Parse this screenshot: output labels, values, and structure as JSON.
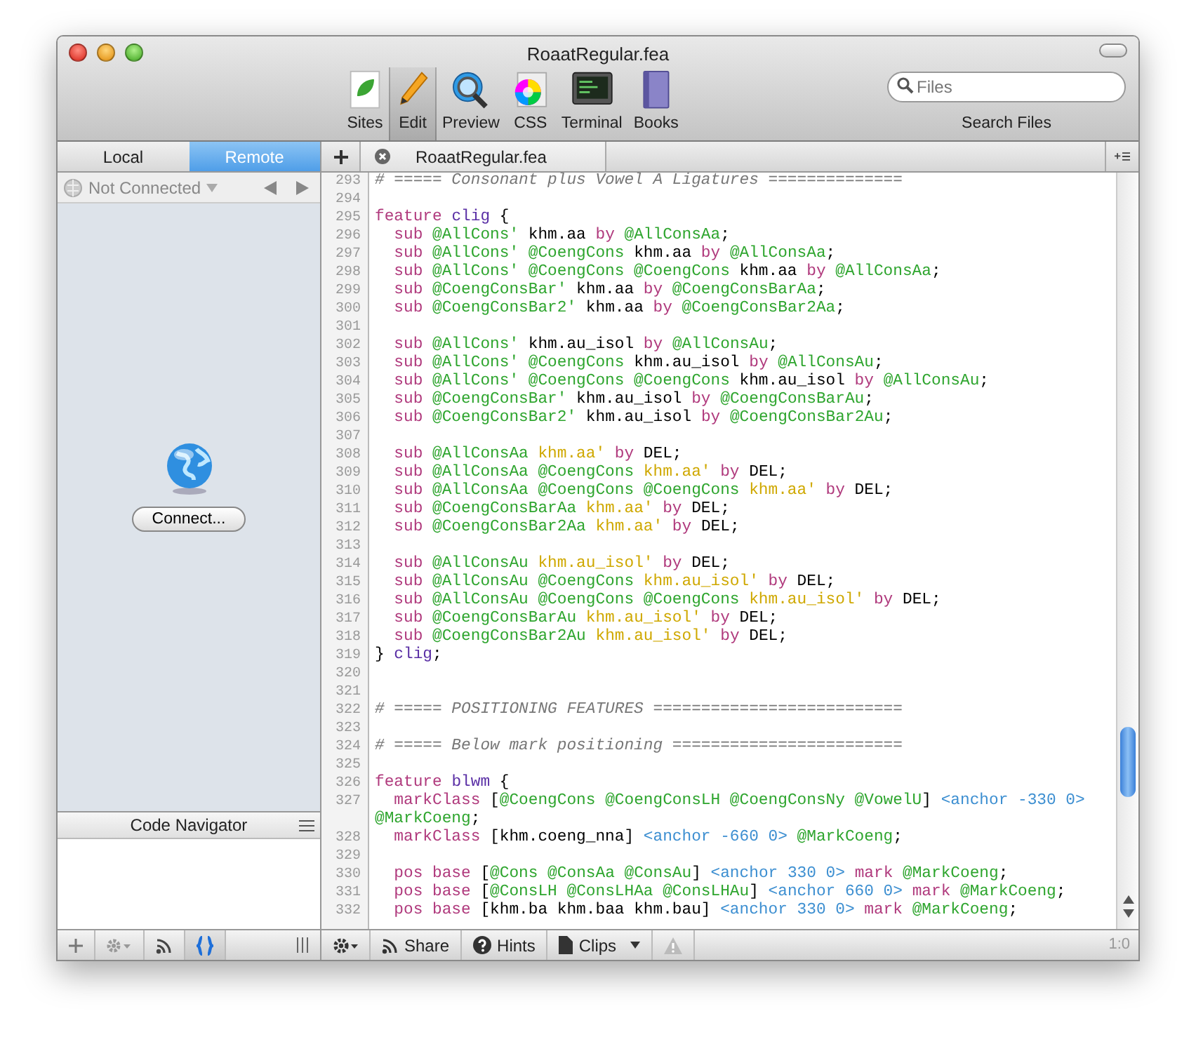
{
  "window": {
    "title": "RoaatRegular.fea"
  },
  "toolbar": {
    "items": [
      {
        "label": "Sites",
        "selected": false
      },
      {
        "label": "Edit",
        "selected": true
      },
      {
        "label": "Preview",
        "selected": false
      },
      {
        "label": "CSS",
        "selected": false
      },
      {
        "label": "Terminal",
        "selected": false
      },
      {
        "label": "Books",
        "selected": false
      }
    ],
    "search": {
      "placeholder": "Files",
      "label": "Search Files"
    }
  },
  "sidebar": {
    "tabs": [
      {
        "label": "Local",
        "selected": false
      },
      {
        "label": "Remote",
        "selected": true
      }
    ],
    "connection": "Not Connected",
    "connect_button": "Connect...",
    "navigator_title": "Code Navigator",
    "bottom_tools": [
      {
        "kind": "plus",
        "selected": false
      },
      {
        "kind": "gear",
        "selected": false
      },
      {
        "kind": "signal",
        "selected": false
      },
      {
        "kind": "braces",
        "selected": true
      },
      {
        "kind": "grip",
        "selected": false
      }
    ]
  },
  "editor": {
    "tab": "RoaatRegular.fea",
    "lines": [
      {
        "number": "293",
        "tokens": [
          {
            "kind": "comment",
            "text": "# ===== Consonant plus Vowel A Ligatures =============="
          }
        ]
      },
      {
        "number": "294"
      },
      {
        "number": "295",
        "tokens": [
          {
            "kind": "keyword",
            "text": "feature "
          },
          {
            "kind": "tag",
            "text": "clig"
          },
          {
            "kind": "plain",
            "text": " {"
          }
        ]
      },
      {
        "number": "296",
        "tokens": [
          {
            "kind": "keyword",
            "text": "  sub "
          },
          {
            "kind": "group",
            "text": "@AllCons'"
          },
          {
            "kind": "plain",
            "text": " khm.aa "
          },
          {
            "kind": "keyword",
            "text": "by "
          },
          {
            "kind": "group",
            "text": "@AllConsAa"
          },
          {
            "kind": "plain",
            "text": ";"
          }
        ]
      },
      {
        "number": "297",
        "tokens": [
          {
            "kind": "keyword",
            "text": "  sub "
          },
          {
            "kind": "group",
            "text": "@AllCons' @CoengCons"
          },
          {
            "kind": "plain",
            "text": " khm.aa "
          },
          {
            "kind": "keyword",
            "text": "by "
          },
          {
            "kind": "group",
            "text": "@AllConsAa"
          },
          {
            "kind": "plain",
            "text": ";"
          }
        ]
      },
      {
        "number": "298",
        "tokens": [
          {
            "kind": "keyword",
            "text": "  sub "
          },
          {
            "kind": "group",
            "text": "@AllCons' @CoengCons @CoengCons"
          },
          {
            "kind": "plain",
            "text": " khm.aa "
          },
          {
            "kind": "keyword",
            "text": "by "
          },
          {
            "kind": "group",
            "text": "@AllConsAa"
          },
          {
            "kind": "plain",
            "text": ";"
          }
        ]
      },
      {
        "number": "299",
        "tokens": [
          {
            "kind": "keyword",
            "text": "  sub "
          },
          {
            "kind": "group",
            "text": "@CoengConsBar'"
          },
          {
            "kind": "plain",
            "text": " khm.aa "
          },
          {
            "kind": "keyword",
            "text": "by "
          },
          {
            "kind": "group",
            "text": "@CoengConsBarAa"
          },
          {
            "kind": "plain",
            "text": ";"
          }
        ]
      },
      {
        "number": "300",
        "tokens": [
          {
            "kind": "keyword",
            "text": "  sub "
          },
          {
            "kind": "group",
            "text": "@CoengConsBar2'"
          },
          {
            "kind": "plain",
            "text": " khm.aa "
          },
          {
            "kind": "keyword",
            "text": "by "
          },
          {
            "kind": "group",
            "text": "@CoengConsBar2Aa"
          },
          {
            "kind": "plain",
            "text": ";"
          }
        ]
      },
      {
        "number": "301"
      },
      {
        "number": "302",
        "tokens": [
          {
            "kind": "keyword",
            "text": "  sub "
          },
          {
            "kind": "group",
            "text": "@AllCons'"
          },
          {
            "kind": "plain",
            "text": " khm.au_isol "
          },
          {
            "kind": "keyword",
            "text": "by "
          },
          {
            "kind": "group",
            "text": "@AllConsAu"
          },
          {
            "kind": "plain",
            "text": ";"
          }
        ]
      },
      {
        "number": "303",
        "tokens": [
          {
            "kind": "keyword",
            "text": "  sub "
          },
          {
            "kind": "group",
            "text": "@AllCons' @CoengCons"
          },
          {
            "kind": "plain",
            "text": " khm.au_isol "
          },
          {
            "kind": "keyword",
            "text": "by "
          },
          {
            "kind": "group",
            "text": "@AllConsAu"
          },
          {
            "kind": "plain",
            "text": ";"
          }
        ]
      },
      {
        "number": "304",
        "tokens": [
          {
            "kind": "keyword",
            "text": "  sub "
          },
          {
            "kind": "group",
            "text": "@AllCons' @CoengCons @CoengCons"
          },
          {
            "kind": "plain",
            "text": " khm.au_isol "
          },
          {
            "kind": "keyword",
            "text": "by "
          },
          {
            "kind": "group",
            "text": "@AllConsAu"
          },
          {
            "kind": "plain",
            "text": ";"
          }
        ]
      },
      {
        "number": "305",
        "tokens": [
          {
            "kind": "keyword",
            "text": "  sub "
          },
          {
            "kind": "group",
            "text": "@CoengConsBar'"
          },
          {
            "kind": "plain",
            "text": " khm.au_isol "
          },
          {
            "kind": "keyword",
            "text": "by "
          },
          {
            "kind": "group",
            "text": "@CoengConsBarAu"
          },
          {
            "kind": "plain",
            "text": ";"
          }
        ]
      },
      {
        "number": "306",
        "tokens": [
          {
            "kind": "keyword",
            "text": "  sub "
          },
          {
            "kind": "group",
            "text": "@CoengConsBar2'"
          },
          {
            "kind": "plain",
            "text": " khm.au_isol "
          },
          {
            "kind": "keyword",
            "text": "by "
          },
          {
            "kind": "group",
            "text": "@CoengConsBar2Au"
          },
          {
            "kind": "plain",
            "text": ";"
          }
        ]
      },
      {
        "number": "307"
      },
      {
        "number": "308",
        "tokens": [
          {
            "kind": "keyword",
            "text": "  sub "
          },
          {
            "kind": "group",
            "text": "@AllConsAa "
          },
          {
            "kind": "glyph",
            "text": "khm.aa' "
          },
          {
            "kind": "keyword",
            "text": "by "
          },
          {
            "kind": "plain",
            "text": "DEL;"
          }
        ]
      },
      {
        "number": "309",
        "tokens": [
          {
            "kind": "keyword",
            "text": "  sub "
          },
          {
            "kind": "group",
            "text": "@AllConsAa @CoengCons "
          },
          {
            "kind": "glyph",
            "text": "khm.aa' "
          },
          {
            "kind": "keyword",
            "text": "by "
          },
          {
            "kind": "plain",
            "text": "DEL;"
          }
        ]
      },
      {
        "number": "310",
        "tokens": [
          {
            "kind": "keyword",
            "text": "  sub "
          },
          {
            "kind": "group",
            "text": "@AllConsAa @CoengCons @CoengCons "
          },
          {
            "kind": "glyph",
            "text": "khm.aa' "
          },
          {
            "kind": "keyword",
            "text": "by "
          },
          {
            "kind": "plain",
            "text": "DEL;"
          }
        ]
      },
      {
        "number": "311",
        "tokens": [
          {
            "kind": "keyword",
            "text": "  sub "
          },
          {
            "kind": "group",
            "text": "@CoengConsBarAa "
          },
          {
            "kind": "glyph",
            "text": "khm.aa' "
          },
          {
            "kind": "keyword",
            "text": "by "
          },
          {
            "kind": "plain",
            "text": "DEL;"
          }
        ]
      },
      {
        "number": "312",
        "tokens": [
          {
            "kind": "keyword",
            "text": "  sub "
          },
          {
            "kind": "group",
            "text": "@CoengConsBar2Aa "
          },
          {
            "kind": "glyph",
            "text": "khm.aa' "
          },
          {
            "kind": "keyword",
            "text": "by "
          },
          {
            "kind": "plain",
            "text": "DEL;"
          }
        ]
      },
      {
        "number": "313"
      },
      {
        "number": "314",
        "tokens": [
          {
            "kind": "keyword",
            "text": "  sub "
          },
          {
            "kind": "group",
            "text": "@AllConsAu "
          },
          {
            "kind": "glyph",
            "text": "khm.au_isol' "
          },
          {
            "kind": "keyword",
            "text": "by "
          },
          {
            "kind": "plain",
            "text": "DEL;"
          }
        ]
      },
      {
        "number": "315",
        "tokens": [
          {
            "kind": "keyword",
            "text": "  sub "
          },
          {
            "kind": "group",
            "text": "@AllConsAu @CoengCons "
          },
          {
            "kind": "glyph",
            "text": "khm.au_isol' "
          },
          {
            "kind": "keyword",
            "text": "by "
          },
          {
            "kind": "plain",
            "text": "DEL;"
          }
        ]
      },
      {
        "number": "316",
        "tokens": [
          {
            "kind": "keyword",
            "text": "  sub "
          },
          {
            "kind": "group",
            "text": "@AllConsAu @CoengCons @CoengCons "
          },
          {
            "kind": "glyph",
            "text": "khm.au_isol' "
          },
          {
            "kind": "keyword",
            "text": "by "
          },
          {
            "kind": "plain",
            "text": "DEL;"
          }
        ]
      },
      {
        "number": "317",
        "tokens": [
          {
            "kind": "keyword",
            "text": "  sub "
          },
          {
            "kind": "group",
            "text": "@CoengConsBarAu "
          },
          {
            "kind": "glyph",
            "text": "khm.au_isol' "
          },
          {
            "kind": "keyword",
            "text": "by "
          },
          {
            "kind": "plain",
            "text": "DEL;"
          }
        ]
      },
      {
        "number": "318",
        "tokens": [
          {
            "kind": "keyword",
            "text": "  sub "
          },
          {
            "kind": "group",
            "text": "@CoengConsBar2Au "
          },
          {
            "kind": "glyph",
            "text": "khm.au_isol' "
          },
          {
            "kind": "keyword",
            "text": "by "
          },
          {
            "kind": "plain",
            "text": "DEL;"
          }
        ]
      },
      {
        "number": "319",
        "tokens": [
          {
            "kind": "plain",
            "text": "} "
          },
          {
            "kind": "tag",
            "text": "clig"
          },
          {
            "kind": "plain",
            "text": ";"
          }
        ]
      },
      {
        "number": "320"
      },
      {
        "number": "321"
      },
      {
        "number": "322",
        "tokens": [
          {
            "kind": "comment",
            "text": "# ===== POSITIONING FEATURES =========================="
          }
        ]
      },
      {
        "number": "323"
      },
      {
        "number": "324",
        "tokens": [
          {
            "kind": "comment",
            "text": "# ===== Below mark positioning ========================"
          }
        ]
      },
      {
        "number": "325"
      },
      {
        "number": "326",
        "tokens": [
          {
            "kind": "keyword",
            "text": "feature "
          },
          {
            "kind": "tag",
            "text": "blwm"
          },
          {
            "kind": "plain",
            "text": " {"
          }
        ]
      },
      {
        "number": "327",
        "tokens": [
          {
            "kind": "keyword",
            "text": "  markClass "
          },
          {
            "kind": "plain",
            "text": "["
          },
          {
            "kind": "group",
            "text": "@CoengCons @CoengConsLH @CoengConsNy @VowelU"
          },
          {
            "kind": "plain",
            "text": "] "
          },
          {
            "kind": "anchor",
            "text": "<anchor -330 0> "
          },
          {
            "kind": "group",
            "text": "@MarkCoeng"
          },
          {
            "kind": "plain",
            "text": ";"
          }
        ]
      },
      {
        "number": "328",
        "tokens": [
          {
            "kind": "keyword",
            "text": "  markClass "
          },
          {
            "kind": "plain",
            "text": "[khm.coeng_nna] "
          },
          {
            "kind": "anchor",
            "text": "<anchor -660 0> "
          },
          {
            "kind": "group",
            "text": "@MarkCoeng"
          },
          {
            "kind": "plain",
            "text": ";"
          }
        ]
      },
      {
        "number": "329"
      },
      {
        "number": "330",
        "tokens": [
          {
            "kind": "keyword",
            "text": "  pos base "
          },
          {
            "kind": "plain",
            "text": "["
          },
          {
            "kind": "group",
            "text": "@Cons @ConsAa @ConsAu"
          },
          {
            "kind": "plain",
            "text": "] "
          },
          {
            "kind": "anchor",
            "text": "<anchor 330 0> "
          },
          {
            "kind": "keyword",
            "text": "mark "
          },
          {
            "kind": "group",
            "text": "@MarkCoeng"
          },
          {
            "kind": "plain",
            "text": ";"
          }
        ]
      },
      {
        "number": "331",
        "tokens": [
          {
            "kind": "keyword",
            "text": "  pos base "
          },
          {
            "kind": "plain",
            "text": "["
          },
          {
            "kind": "group",
            "text": "@ConsLH @ConsLHAa @ConsLHAu"
          },
          {
            "kind": "plain",
            "text": "] "
          },
          {
            "kind": "anchor",
            "text": "<anchor 660 0> "
          },
          {
            "kind": "keyword",
            "text": "mark "
          },
          {
            "kind": "group",
            "text": "@MarkCoeng"
          },
          {
            "kind": "plain",
            "text": ";"
          }
        ]
      },
      {
        "number": "332",
        "tokens": [
          {
            "kind": "keyword",
            "text": "  pos base "
          },
          {
            "kind": "plain",
            "text": "[khm.ba khm.baa khm.bau] "
          },
          {
            "kind": "anchor",
            "text": "<anchor 330 0> "
          },
          {
            "kind": "keyword",
            "text": "mark "
          },
          {
            "kind": "group",
            "text": "@MarkCoeng"
          },
          {
            "kind": "plain",
            "text": ";"
          }
        ]
      }
    ]
  },
  "status_bar": {
    "buttons": [
      {
        "kind": "share",
        "label": "Share"
      },
      {
        "kind": "hints",
        "label": "Hints"
      },
      {
        "kind": "clips",
        "label": "Clips"
      }
    ],
    "position": "1:0"
  }
}
